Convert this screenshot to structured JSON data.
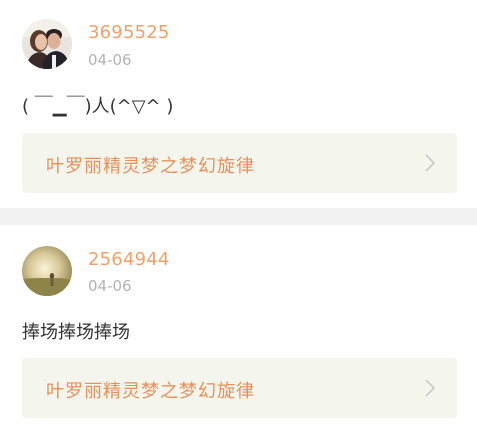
{
  "posts": [
    {
      "username": "3695525",
      "date": "04-06",
      "content": "( ￣▁￣)人(^▽^ )",
      "card_title": "叶罗丽精灵梦之梦幻旋律",
      "avatar_icon": "couple-photo-avatar"
    },
    {
      "username": "2564944",
      "date": "04-06",
      "content": "捧场捧场捧场",
      "card_title": "叶罗丽精灵梦之梦幻旋律",
      "avatar_icon": "field-photo-avatar"
    }
  ],
  "colors": {
    "username": "#f0a068",
    "date": "#b3b3b3",
    "card_bg": "#f4f6ee",
    "card_title": "#ec8e57",
    "separator": "#f2f2f2"
  }
}
